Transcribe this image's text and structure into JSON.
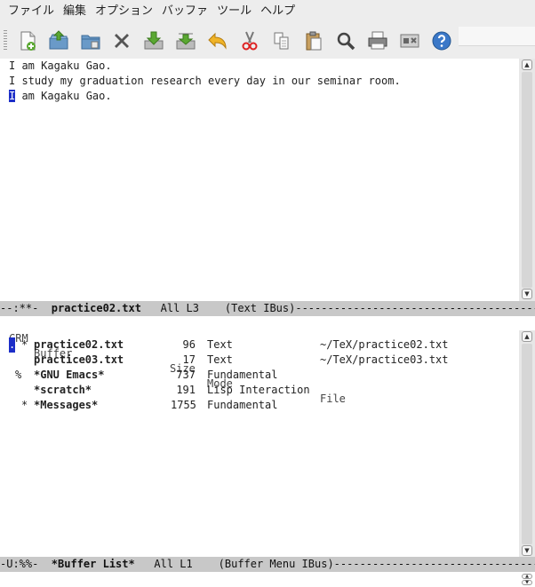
{
  "menu": [
    "ファイル",
    "編集",
    "オプション",
    "バッファ",
    "ツール",
    "ヘルプ"
  ],
  "toolbar": {
    "buttons": [
      {
        "name": "new-file-icon"
      },
      {
        "name": "open-file-icon"
      },
      {
        "name": "open-directory-icon"
      },
      {
        "name": "close-buffer-icon"
      },
      {
        "name": "save-icon"
      },
      {
        "name": "save-as-icon"
      },
      {
        "name": "undo-icon"
      },
      {
        "name": "cut-icon"
      },
      {
        "name": "copy-icon"
      },
      {
        "name": "paste-icon"
      },
      {
        "name": "search-icon"
      },
      {
        "name": "print-icon"
      },
      {
        "name": "preferences-icon"
      },
      {
        "name": "help-icon"
      }
    ]
  },
  "editor": {
    "lines": [
      "I am Kagaku Gao.",
      "I study my graduation research every day in our seminar room."
    ],
    "cursor_char": "I",
    "cursor_rest": " am Kagaku Gao."
  },
  "modeline_top": {
    "prefix": "--:**-  ",
    "buffer": "practice02.txt",
    "rest": "   All L3    (Text IBus)-----------------------------------------"
  },
  "buffer_list": {
    "headers": {
      "crm": "CRM",
      "buffer": "Buffer",
      "size": "Size",
      "mode": "Mode",
      "file": "File"
    },
    "rows": [
      {
        "c": ".",
        "r": "",
        "m": "*",
        "buffer": "practice02.txt",
        "size": "96",
        "mode": "Text",
        "file": "~/TeX/practice02.txt"
      },
      {
        "c": "",
        "r": "",
        "m": "",
        "buffer": "practice03.txt",
        "size": "17",
        "mode": "Text",
        "file": "~/TeX/practice03.txt"
      },
      {
        "c": "",
        "r": "%",
        "m": "",
        "buffer": "*GNU Emacs*",
        "size": "737",
        "mode": "Fundamental",
        "file": ""
      },
      {
        "c": "",
        "r": "",
        "m": "",
        "buffer": "*scratch*",
        "size": "191",
        "mode": "Lisp Interaction",
        "file": ""
      },
      {
        "c": "",
        "r": "",
        "m": "*",
        "buffer": "*Messages*",
        "size": "1755",
        "mode": "Fundamental",
        "file": ""
      }
    ]
  },
  "modeline_bottom": {
    "prefix": "-U:%%-  ",
    "buffer": "*Buffer List*",
    "rest": "   All L1    (Buffer Menu IBus)------------------------------------"
  }
}
